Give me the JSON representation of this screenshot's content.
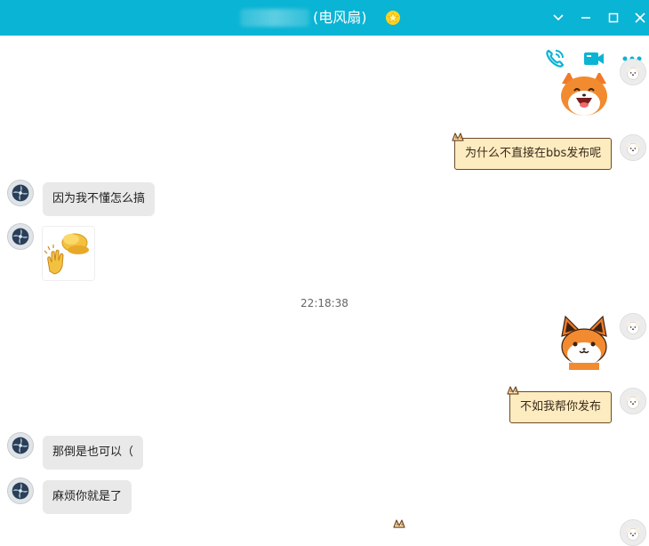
{
  "window": {
    "title": "(电风扇)",
    "title_blurred": true,
    "accent": "#0ab4d4"
  },
  "toolbar": {
    "icons": [
      "phone-call-icon",
      "video-call-icon",
      "more-icon"
    ]
  },
  "messages": [
    {
      "side": "right",
      "type": "sticker",
      "sticker": "fox-laughing"
    },
    {
      "side": "right",
      "type": "text",
      "text": "为什么不直接在bbs发布呢"
    },
    {
      "side": "left",
      "type": "text",
      "text": "因为我不懂怎么搞"
    },
    {
      "side": "left",
      "type": "sticker",
      "sticker": "clapping-hands"
    },
    {
      "side": "center",
      "type": "time",
      "text": "22:18:38"
    },
    {
      "side": "right",
      "type": "sticker",
      "sticker": "fox-smiling"
    },
    {
      "side": "right",
      "type": "text",
      "text": "不如我帮你发布"
    },
    {
      "side": "left",
      "type": "text",
      "text": "那倒是也可以（"
    },
    {
      "side": "left",
      "type": "text",
      "text": "麻烦你就是了"
    }
  ],
  "colors": {
    "left_bubble": "#e9e9e9",
    "right_bubble": "#fdecc0",
    "right_bubble_border": "#6b4a2a"
  }
}
